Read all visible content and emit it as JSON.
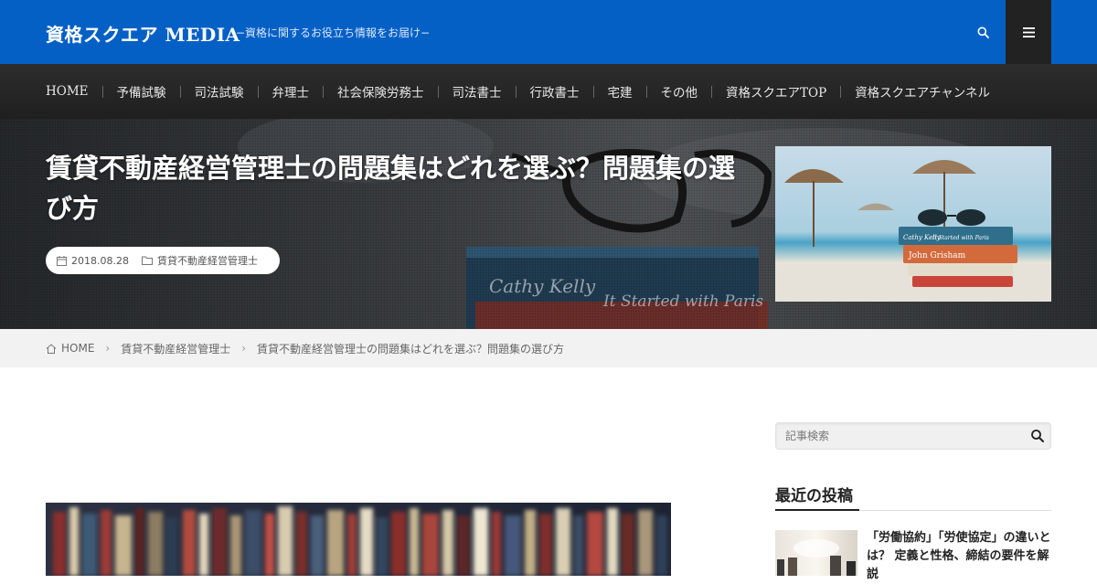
{
  "header": {
    "logo": "資格スクエア MEDIA",
    "tagline": "−資格に関するお役立ち情報をお届け−",
    "search_icon": "search-icon",
    "menu_icon": "hamburger-menu-icon"
  },
  "nav": {
    "items": [
      {
        "label": "HOME"
      },
      {
        "label": "予備試験"
      },
      {
        "label": "司法試験"
      },
      {
        "label": "弁理士"
      },
      {
        "label": "社会保険労務士"
      },
      {
        "label": "司法書士"
      },
      {
        "label": "行政書士"
      },
      {
        "label": "宅建"
      },
      {
        "label": "その他"
      },
      {
        "label": "資格スクエアTOP"
      },
      {
        "label": "資格スクエアチャンネル"
      }
    ]
  },
  "hero": {
    "title": "賃貸不動産経営管理士の問題集はどれを選ぶ？問題集の選び方",
    "date": "2018.08.28",
    "category": "賃貸不動産経営管理士",
    "book_text_1": "Cathy Kelly",
    "book_text_2": "It Started with Paris",
    "thumb_book_1": "Cathy Kelly",
    "thumb_book_2": "It Started with Paris",
    "thumb_book_3": "John Grisham"
  },
  "breadcrumb": {
    "items": [
      {
        "label": "HOME"
      },
      {
        "label": "賃貸不動産経営管理士"
      },
      {
        "label": "賃貸不動産経営管理士の問題集はどれを選ぶ？問題集の選び方"
      }
    ]
  },
  "sidebar": {
    "search_placeholder": "記事検索",
    "recent_title": "最近の投稿",
    "recent_posts": [
      {
        "title": "「労働協約」「労使協定」の違いとは？ 定義と性格、締結の要件を解説"
      }
    ]
  },
  "colors": {
    "header_bg": "#0560c5",
    "nav_bg": "#262626",
    "menu_btn_bg": "#222222",
    "breadcrumb_bg": "#f2f2f2"
  }
}
